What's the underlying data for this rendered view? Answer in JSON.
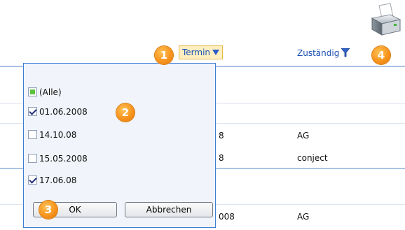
{
  "header": {
    "termin_label": "Termin",
    "zustaendig_label": "Zuständig"
  },
  "callouts": [
    "1",
    "2",
    "3",
    "4"
  ],
  "filter_popup": {
    "options": [
      {
        "label": "(Alle)",
        "state": "partial"
      },
      {
        "label": "01.06.2008",
        "state": "checked"
      },
      {
        "label": "14.10.08",
        "state": "unchecked"
      },
      {
        "label": "15.05.2008",
        "state": "unchecked"
      },
      {
        "label": "17.06.08",
        "state": "checked"
      }
    ],
    "ok_label": "OK",
    "cancel_label": "Abbrechen"
  },
  "table_rows": [
    {
      "termin_fragment": "8",
      "zustaendig": "AG"
    },
    {
      "termin_fragment": "8",
      "zustaendig": "conject"
    },
    {
      "termin_fragment": "008",
      "zustaendig": "AG"
    }
  ],
  "colors": {
    "link": "#1a4fb4",
    "badge": "#f7941d",
    "popup_border": "#3c7fd5",
    "header_rule": "#a9c4e4"
  },
  "icons": [
    "printer-icon",
    "dropdown-arrow-icon",
    "funnel-filter-icon",
    "checkbox-icon"
  ]
}
